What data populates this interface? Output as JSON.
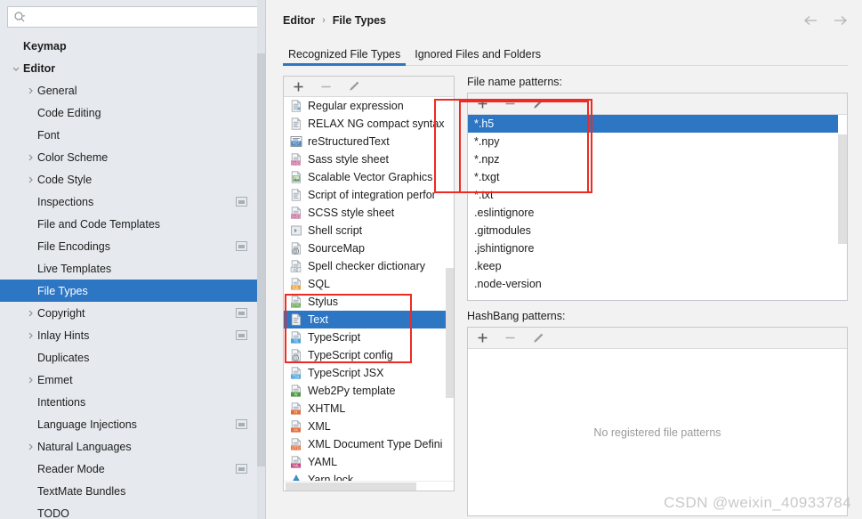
{
  "sidebar": {
    "search": {
      "value": "",
      "placeholder": "",
      "icon": "search-icon"
    },
    "items": [
      {
        "label": "Keymap",
        "depth": 0,
        "bold": true,
        "arrow": "none",
        "cfg": false,
        "selected": false
      },
      {
        "label": "Editor",
        "depth": 0,
        "bold": true,
        "arrow": "down",
        "cfg": false,
        "selected": false
      },
      {
        "label": "General",
        "depth": 1,
        "bold": false,
        "arrow": "right",
        "cfg": false,
        "selected": false
      },
      {
        "label": "Code Editing",
        "depth": 1,
        "bold": false,
        "arrow": "none",
        "cfg": false,
        "selected": false
      },
      {
        "label": "Font",
        "depth": 1,
        "bold": false,
        "arrow": "none",
        "cfg": false,
        "selected": false
      },
      {
        "label": "Color Scheme",
        "depth": 1,
        "bold": false,
        "arrow": "right",
        "cfg": false,
        "selected": false
      },
      {
        "label": "Code Style",
        "depth": 1,
        "bold": false,
        "arrow": "right",
        "cfg": false,
        "selected": false
      },
      {
        "label": "Inspections",
        "depth": 1,
        "bold": false,
        "arrow": "none",
        "cfg": true,
        "selected": false
      },
      {
        "label": "File and Code Templates",
        "depth": 1,
        "bold": false,
        "arrow": "none",
        "cfg": false,
        "selected": false
      },
      {
        "label": "File Encodings",
        "depth": 1,
        "bold": false,
        "arrow": "none",
        "cfg": true,
        "selected": false
      },
      {
        "label": "Live Templates",
        "depth": 1,
        "bold": false,
        "arrow": "none",
        "cfg": false,
        "selected": false
      },
      {
        "label": "File Types",
        "depth": 1,
        "bold": false,
        "arrow": "none",
        "cfg": false,
        "selected": true
      },
      {
        "label": "Copyright",
        "depth": 1,
        "bold": false,
        "arrow": "right",
        "cfg": true,
        "selected": false
      },
      {
        "label": "Inlay Hints",
        "depth": 1,
        "bold": false,
        "arrow": "right",
        "cfg": true,
        "selected": false
      },
      {
        "label": "Duplicates",
        "depth": 1,
        "bold": false,
        "arrow": "none",
        "cfg": false,
        "selected": false
      },
      {
        "label": "Emmet",
        "depth": 1,
        "bold": false,
        "arrow": "right",
        "cfg": false,
        "selected": false
      },
      {
        "label": "Intentions",
        "depth": 1,
        "bold": false,
        "arrow": "none",
        "cfg": false,
        "selected": false
      },
      {
        "label": "Language Injections",
        "depth": 1,
        "bold": false,
        "arrow": "none",
        "cfg": true,
        "selected": false
      },
      {
        "label": "Natural Languages",
        "depth": 1,
        "bold": false,
        "arrow": "right",
        "cfg": false,
        "selected": false
      },
      {
        "label": "Reader Mode",
        "depth": 1,
        "bold": false,
        "arrow": "none",
        "cfg": true,
        "selected": false
      },
      {
        "label": "TextMate Bundles",
        "depth": 1,
        "bold": false,
        "arrow": "none",
        "cfg": false,
        "selected": false
      },
      {
        "label": "TODO",
        "depth": 1,
        "bold": false,
        "arrow": "none",
        "cfg": false,
        "selected": false
      }
    ]
  },
  "header": {
    "breadcrumb_root": "Editor",
    "breadcrumb_sep": "›",
    "breadcrumb_current": "File Types",
    "back_icon": "arrow-left-icon",
    "forward_icon": "arrow-right-icon"
  },
  "tabs": [
    {
      "label": "Recognized File Types",
      "active": true
    },
    {
      "label": "Ignored Files and Folders",
      "active": false
    }
  ],
  "toolbar": {
    "add_label": "+",
    "remove_label": "−",
    "edit_label": "✎",
    "add_icon": "plus-icon",
    "remove_icon": "minus-icon",
    "edit_icon": "pencil-icon"
  },
  "file_types": {
    "items": [
      {
        "label": "Regular expression",
        "icon": "regexp-file-icon",
        "selected": false
      },
      {
        "label": "RELAX NG compact syntax",
        "icon": "generic-text-file-icon",
        "selected": false
      },
      {
        "label": "reStructuredText",
        "icon": "rst-file-icon",
        "selected": false
      },
      {
        "label": "Sass style sheet",
        "icon": "sass-file-icon",
        "selected": false
      },
      {
        "label": "Scalable Vector Graphics",
        "icon": "svg-file-icon",
        "selected": false
      },
      {
        "label": "Script of integration perfor",
        "icon": "generic-text-file-icon",
        "selected": false
      },
      {
        "label": "SCSS style sheet",
        "icon": "scss-file-icon",
        "selected": false
      },
      {
        "label": "Shell script",
        "icon": "shell-script-icon",
        "selected": false
      },
      {
        "label": "SourceMap",
        "icon": "sourcemap-file-icon",
        "selected": false
      },
      {
        "label": "Spell checker dictionary",
        "icon": "dictionary-file-icon",
        "selected": false
      },
      {
        "label": "SQL",
        "icon": "sql-file-icon",
        "selected": false
      },
      {
        "label": "Stylus",
        "icon": "stylus-file-icon",
        "selected": false
      },
      {
        "label": "Text",
        "icon": "text-file-icon",
        "selected": true
      },
      {
        "label": "TypeScript",
        "icon": "typescript-file-icon",
        "selected": false
      },
      {
        "label": "TypeScript config",
        "icon": "typescript-config-file-icon",
        "selected": false
      },
      {
        "label": "TypeScript JSX",
        "icon": "tsx-file-icon",
        "selected": false
      },
      {
        "label": "Web2Py template",
        "icon": "web2py-file-icon",
        "selected": false
      },
      {
        "label": "XHTML",
        "icon": "xhtml-file-icon",
        "selected": false
      },
      {
        "label": "XML",
        "icon": "xml-file-icon",
        "selected": false
      },
      {
        "label": "XML Document Type Defini",
        "icon": "dtd-file-icon",
        "selected": false
      },
      {
        "label": "YAML",
        "icon": "yaml-file-icon",
        "selected": false
      },
      {
        "label": "Yarn lock",
        "icon": "yarn-lock-icon",
        "selected": false
      }
    ]
  },
  "patterns_panel": {
    "label": "File name patterns:",
    "items": [
      {
        "label": "*.h5",
        "selected": true
      },
      {
        "label": "*.npy",
        "selected": false
      },
      {
        "label": "*.npz",
        "selected": false
      },
      {
        "label": "*.txgt",
        "selected": false
      },
      {
        "label": "*.txt",
        "selected": false
      },
      {
        "label": ".eslintignore",
        "selected": false
      },
      {
        "label": ".gitmodules",
        "selected": false
      },
      {
        "label": ".jshintignore",
        "selected": false
      },
      {
        "label": ".keep",
        "selected": false
      },
      {
        "label": ".node-version",
        "selected": false
      }
    ]
  },
  "hashbang_panel": {
    "label": "HashBang patterns:",
    "empty_text": "No registered file patterns"
  },
  "watermark": "CSDN @weixin_40933784",
  "colors": {
    "accent": "#2d76c4",
    "annotation": "#ee2b22",
    "sidebar_bg": "#e6eaee",
    "main_bg": "#f2f2f2"
  }
}
